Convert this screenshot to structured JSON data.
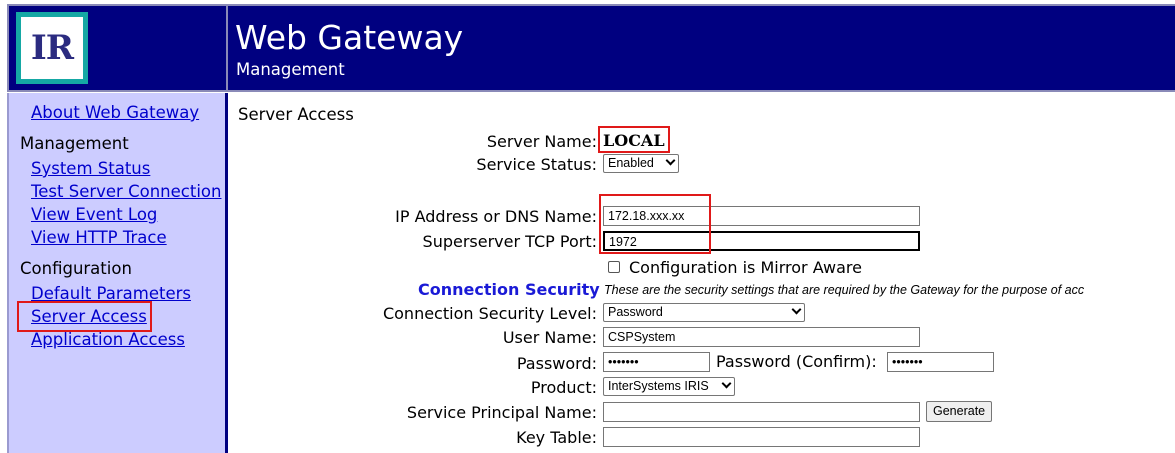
{
  "header": {
    "logo_text": "IR",
    "title": "Web Gateway",
    "subtitle": "Management"
  },
  "sidebar": {
    "about_link": "About Web Gateway",
    "management_heading": "Management",
    "management_links": [
      "System Status",
      "Test Server Connection",
      "View Event Log",
      "View HTTP Trace"
    ],
    "configuration_heading": "Configuration",
    "configuration_links": [
      "Default Parameters",
      "Server Access",
      "Application Access"
    ]
  },
  "main": {
    "section_title": "Server Access",
    "server_name_label": "Server Name:",
    "server_name_value": "LOCAL",
    "service_status_label": "Service Status:",
    "service_status_value": "Enabled",
    "ip_label": "IP Address or DNS Name:",
    "ip_value": "172.18.xxx.xx",
    "port_label": "Superserver TCP Port:",
    "port_value": "1972",
    "mirror_aware_label": "Configuration is Mirror Aware",
    "connection_security_heading": "Connection Security",
    "connection_security_note": "These are the security settings that are required by the Gateway for the purpose of acc",
    "security_level_label": "Connection Security Level:",
    "security_level_value": "Password",
    "user_name_label": "User Name:",
    "user_name_value": "CSPSystem",
    "password_label": "Password:",
    "password_value": "•••••••",
    "password_confirm_label": "Password (Confirm):",
    "password_confirm_value": "•••••••",
    "product_label": "Product:",
    "product_value": "InterSystems IRIS",
    "spn_label": "Service Principal Name:",
    "spn_value": "",
    "generate_button": "Generate",
    "key_table_label": "Key Table:",
    "key_table_value": ""
  },
  "colors": {
    "header_bg": "#000080",
    "sidebar_bg": "#ccccff",
    "link": "#0000cc",
    "heading_blue": "#1a1ad6",
    "highlight_red": "#e01919",
    "logo_teal": "#15a8a4"
  }
}
